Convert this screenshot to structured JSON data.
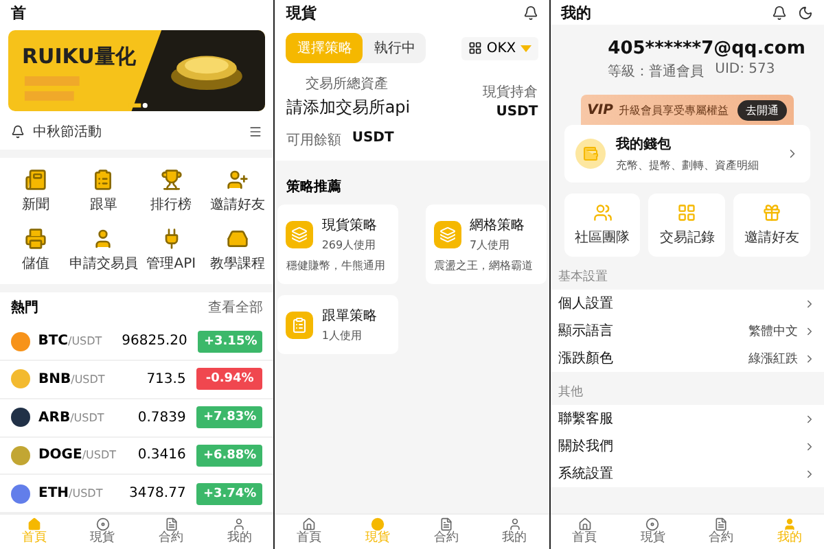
{
  "home": {
    "title": "首",
    "banner": {
      "kind": "picture",
      "headline": "RUIKU量化"
    },
    "notice": "中秋節活動",
    "shortcuts": [
      {
        "label": "新聞"
      },
      {
        "label": "跟單"
      },
      {
        "label": "排行榜"
      },
      {
        "label": "邀請好友"
      },
      {
        "label": "儲值"
      },
      {
        "label": "申請交易員"
      },
      {
        "label": "管理API"
      },
      {
        "label": "教學課程"
      }
    ],
    "hot": {
      "title": "熱門",
      "more": "查看全部",
      "rows": [
        {
          "symbol": "BTC",
          "quote": "/USDT",
          "price": "96825.20",
          "change": "+3.15%",
          "color": "#f7931a",
          "up": true
        },
        {
          "symbol": "BNB",
          "quote": "/USDT",
          "price": "713.5",
          "change": "-0.94%",
          "color": "#f3ba2f",
          "up": false
        },
        {
          "symbol": "ARB",
          "quote": "/USDT",
          "price": "0.7839",
          "change": "+7.83%",
          "color": "#213147",
          "up": true
        },
        {
          "symbol": "DOGE",
          "quote": "/USDT",
          "price": "0.3416",
          "change": "+6.88%",
          "color": "#c2a633",
          "up": true
        },
        {
          "symbol": "ETH",
          "quote": "/USDT",
          "price": "3478.77",
          "change": "+3.74%",
          "color": "#627eea",
          "up": true
        }
      ]
    },
    "tabbar": [
      {
        "label": "首頁",
        "selected": true
      },
      {
        "label": "現貨",
        "selected": false
      },
      {
        "label": "合約",
        "selected": false
      },
      {
        "label": "我的",
        "selected": false
      }
    ]
  },
  "spot": {
    "title": "現貨",
    "tabs": [
      {
        "label": "選擇策略",
        "selected": true
      },
      {
        "label": "執行中",
        "selected": false
      }
    ],
    "exchange": "OKX",
    "assets": {
      "label": "交易所總資產",
      "value": "請添加交易所api",
      "holding_label": "現貨持倉",
      "holding_unit": "USDT",
      "available_label": "可用餘額",
      "available_unit": "USDT"
    },
    "section": "策略推薦",
    "strategies": [
      {
        "name": "現貨策略",
        "users": "269人使用",
        "desc": "穩健賺幣，牛熊通用"
      },
      {
        "name": "網格策略",
        "users": "7人使用",
        "desc": "震盪之王，網格霸道"
      },
      {
        "name": "跟單策略",
        "users": "1人使用"
      }
    ],
    "tabbar": [
      {
        "label": "首頁",
        "selected": false
      },
      {
        "label": "現貨",
        "selected": true
      },
      {
        "label": "合約",
        "selected": false
      },
      {
        "label": "我的",
        "selected": false
      }
    ]
  },
  "profile": {
    "title": "我的",
    "email": "405******7@qq.com",
    "level": "等級：普通會員",
    "uid": "UID: 573",
    "vip": {
      "badge": "VIP",
      "text": "升級會員享受專屬權益",
      "action": "去開通"
    },
    "wallet": {
      "title": "我的錢包",
      "desc": "充幣、提幣、劃轉、資產明細"
    },
    "cards": [
      {
        "label": "社區團隊"
      },
      {
        "label": "交易記錄"
      },
      {
        "label": "邀請好友"
      }
    ],
    "sections": [
      {
        "title": "基本設置",
        "items": [
          {
            "label": "個人設置"
          },
          {
            "label": "顯示語言",
            "value": "繁體中文"
          },
          {
            "label": "漲跌顏色",
            "value": "綠漲紅跌"
          }
        ]
      },
      {
        "title": "其他",
        "items": [
          {
            "label": "聯繫客服"
          },
          {
            "label": "關於我們"
          },
          {
            "label": "系統設置"
          }
        ]
      }
    ],
    "tabbar": [
      {
        "label": "首頁",
        "selected": false
      },
      {
        "label": "現貨",
        "selected": false
      },
      {
        "label": "合約",
        "selected": false
      },
      {
        "label": "我的",
        "selected": true
      }
    ]
  }
}
